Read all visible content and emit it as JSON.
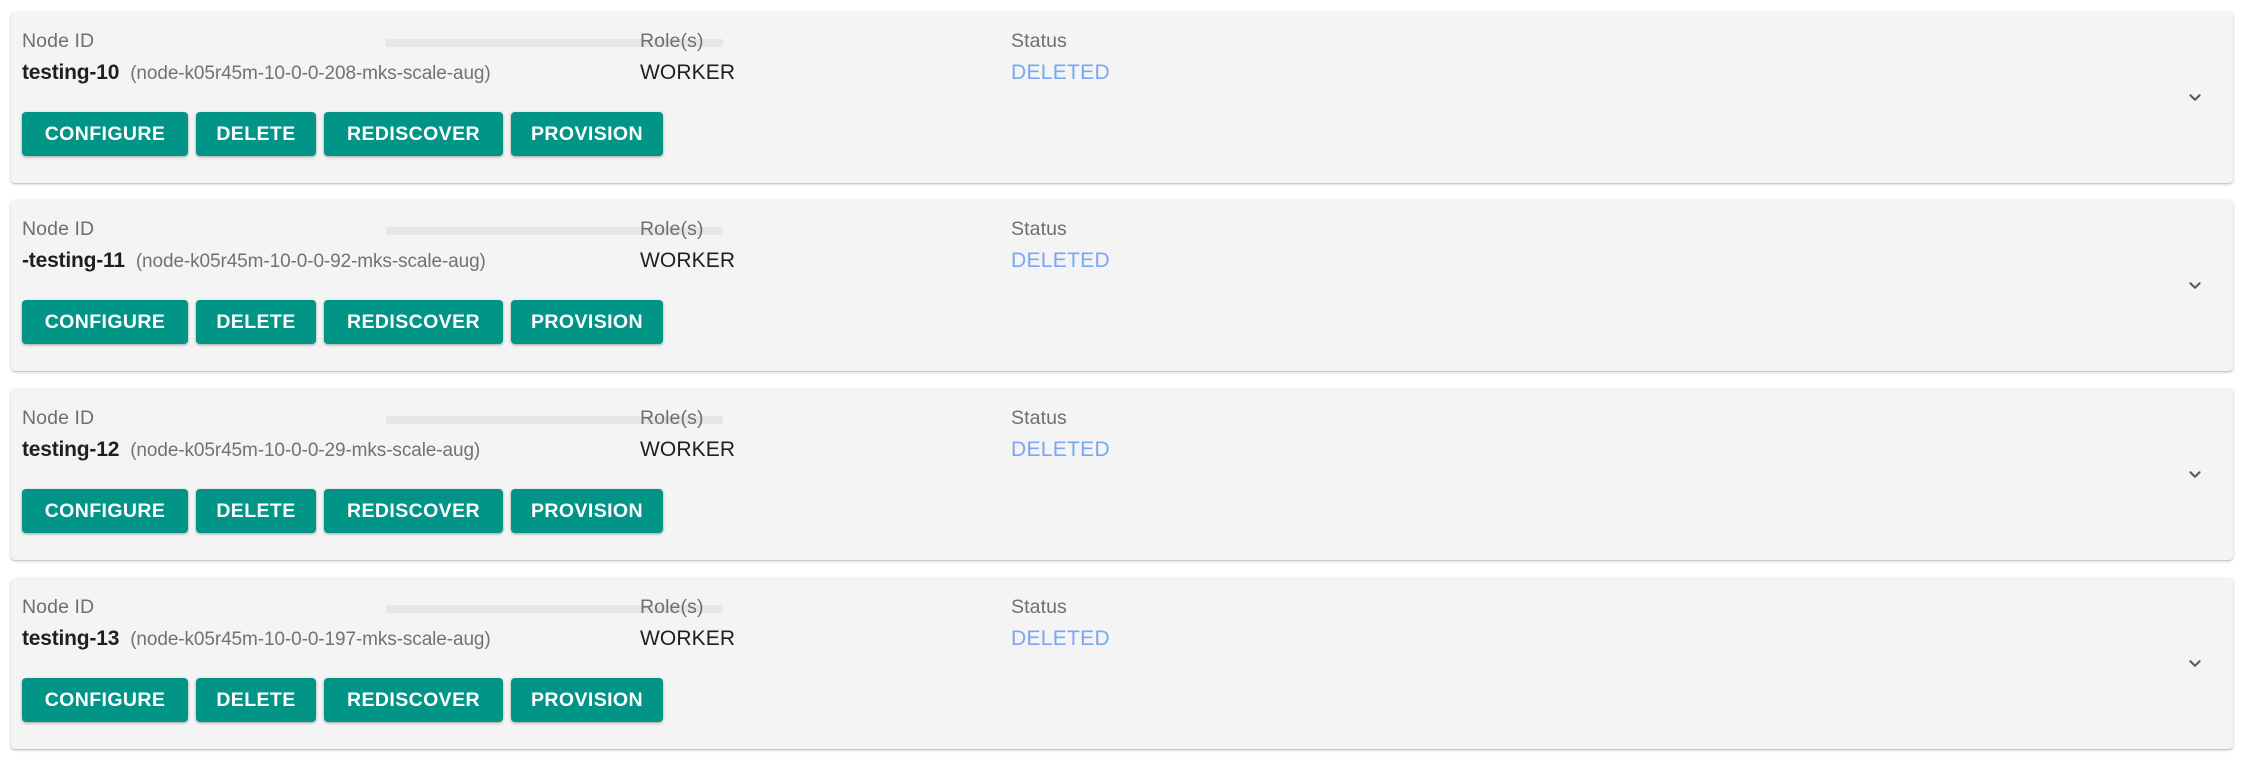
{
  "columns": {
    "node_id_label": "Node ID",
    "roles_label": "Role(s)",
    "status_label": "Status"
  },
  "actions": {
    "configure": "CONFIGURE",
    "delete": "DELETE",
    "rediscover": "REDISCOVER",
    "provision": "PROVISION"
  },
  "icons": {
    "expand": "chevron-down-icon"
  },
  "colors": {
    "button_teal": "#009587",
    "status_deleted": "#79a6f6",
    "card_background": "#f4f4f4",
    "label_gray": "#6f6f6f",
    "skeleton_gray": "#e6e6e6"
  },
  "nodes": [
    {
      "node_id": "testing-10",
      "node_name": "(node-k05r45m-10-0-0-208-mks-scale-aug)",
      "roles": "WORKER",
      "status": "DELETED"
    },
    {
      "node_id": "-testing-11",
      "node_name": "(node-k05r45m-10-0-0-92-mks-scale-aug)",
      "roles": "WORKER",
      "status": "DELETED"
    },
    {
      "node_id": "testing-12",
      "node_name": "(node-k05r45m-10-0-0-29-mks-scale-aug)",
      "roles": "WORKER",
      "status": "DELETED"
    },
    {
      "node_id": "testing-13",
      "node_name": "(node-k05r45m-10-0-0-197-mks-scale-aug)",
      "roles": "WORKER",
      "status": "DELETED"
    }
  ]
}
